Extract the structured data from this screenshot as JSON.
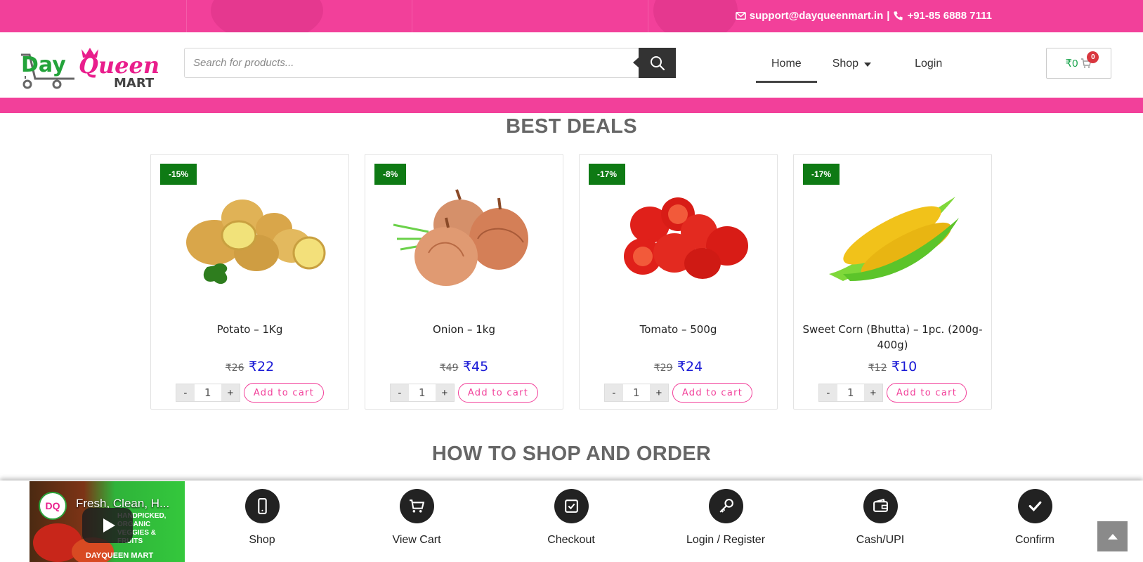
{
  "topbar": {
    "email": "support@dayqueenmart.in",
    "separator": "|",
    "phone": "+91-85 6888 7111"
  },
  "logo": {
    "line1_day": "Day",
    "line1_queen": "Queen",
    "line2": "MART"
  },
  "search": {
    "placeholder": "Search for products..."
  },
  "nav": {
    "home": "Home",
    "shop": "Shop",
    "login": "Login"
  },
  "cart": {
    "amount": "₹0",
    "count": "0"
  },
  "best_deals": {
    "title": "BEST DEALS",
    "add_to_cart_label": "Add to cart",
    "products": [
      {
        "badge": "-15%",
        "name": "Potato – 1Kg",
        "old_price": "₹26",
        "price": "₹22",
        "qty": "1",
        "image": "potato"
      },
      {
        "badge": "-8%",
        "name": "Onion – 1kg",
        "old_price": "₹49",
        "price": "₹45",
        "qty": "1",
        "image": "onion"
      },
      {
        "badge": "-17%",
        "name": "Tomato – 500g",
        "old_price": "₹29",
        "price": "₹24",
        "qty": "1",
        "image": "tomato"
      },
      {
        "badge": "-17%",
        "name": "Sweet Corn (Bhutta) – 1pc. (200g-400g)",
        "old_price": "₹12",
        "price": "₹10",
        "qty": "1",
        "image": "corn"
      }
    ]
  },
  "how_to": {
    "title": "HOW TO SHOP AND ORDER"
  },
  "video": {
    "title": "Fresh, Clean, H...",
    "caption": "HANDPICKED, ORGANIC VEGGIES & FRUITS",
    "brand": "DAYQUEEN MART"
  },
  "steps": [
    {
      "label": "Shop",
      "icon": "phone-icon"
    },
    {
      "label": "View Cart",
      "icon": "cart-icon"
    },
    {
      "label": "Checkout",
      "icon": "checkbox-icon"
    },
    {
      "label": "Login / Register",
      "icon": "key-icon"
    },
    {
      "label": "Cash/UPI",
      "icon": "wallet-icon"
    },
    {
      "label": "Confirm",
      "icon": "check-icon"
    }
  ],
  "colors": {
    "brand_pink": "#f2409a",
    "sale_green": "#0e7a14",
    "price_blue": "#1a1ad6",
    "logo_green": "#23a33a"
  }
}
